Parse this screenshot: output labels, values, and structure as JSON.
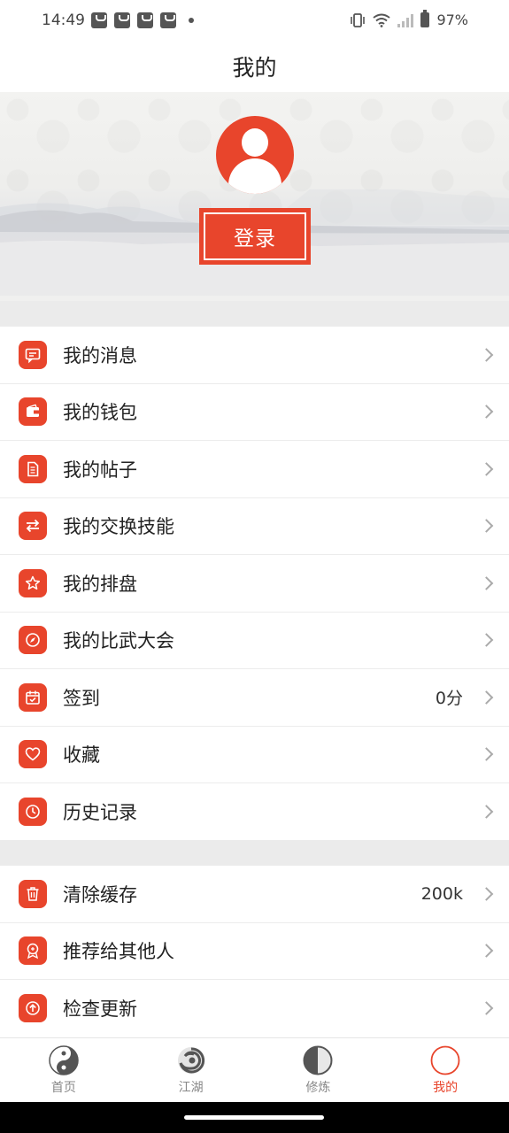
{
  "status_bar": {
    "time": "14:49",
    "notification_icons": [
      "bag-icon",
      "bag-icon",
      "bag-icon",
      "bag-icon"
    ],
    "battery": "97%"
  },
  "header": {
    "title": "我的"
  },
  "profile": {
    "login_label": "登录"
  },
  "menu_group_1": [
    {
      "label": "我的消息",
      "icon": "message-icon",
      "value": ""
    },
    {
      "label": "我的钱包",
      "icon": "wallet-icon",
      "value": ""
    },
    {
      "label": "我的帖子",
      "icon": "document-icon",
      "value": ""
    },
    {
      "label": "我的交换技能",
      "icon": "exchange-icon",
      "value": ""
    },
    {
      "label": "我的排盘",
      "icon": "star-icon",
      "value": ""
    },
    {
      "label": "我的比武大会",
      "icon": "compass-icon",
      "value": ""
    },
    {
      "label": "签到",
      "icon": "calendar-check-icon",
      "value": "0分"
    },
    {
      "label": "收藏",
      "icon": "heart-icon",
      "value": ""
    },
    {
      "label": "历史记录",
      "icon": "clock-icon",
      "value": ""
    }
  ],
  "menu_group_2": [
    {
      "label": "清除缓存",
      "icon": "trash-icon",
      "value": "200k"
    },
    {
      "label": "推荐给其他人",
      "icon": "recommend-icon",
      "value": ""
    },
    {
      "label": "检查更新",
      "icon": "upload-icon",
      "value": ""
    }
  ],
  "bottom_nav": [
    {
      "label": "首页",
      "icon": "yin-yang-icon",
      "active": false
    },
    {
      "label": "江湖",
      "icon": "swirl-icon",
      "active": false
    },
    {
      "label": "修炼",
      "icon": "half-circle-icon",
      "active": false
    },
    {
      "label": "我的",
      "icon": "circle-icon",
      "active": true
    }
  ],
  "colors": {
    "accent": "#e8452c",
    "band": "#ebebeb"
  }
}
